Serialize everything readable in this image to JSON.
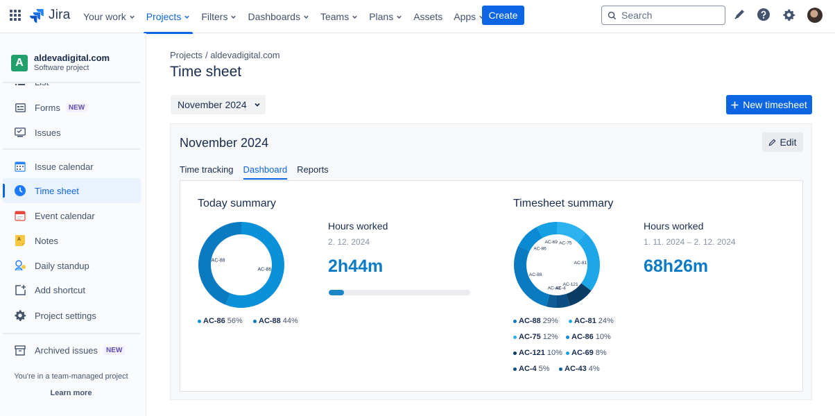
{
  "topnav": {
    "app_name": "Jira",
    "items": [
      {
        "label": "Your work"
      },
      {
        "label": "Projects"
      },
      {
        "label": "Filters"
      },
      {
        "label": "Dashboards"
      },
      {
        "label": "Teams"
      },
      {
        "label": "Plans"
      },
      {
        "label": "Assets"
      },
      {
        "label": "Apps"
      }
    ],
    "active_item": "Projects",
    "create_label": "Create",
    "search_placeholder": "Search",
    "accent": "#0c66e4"
  },
  "sidebar": {
    "project_name": "aldevadigital.com",
    "project_type": "Software project",
    "project_icon_letter": "A",
    "items": [
      {
        "label": "List",
        "icon": "list-icon"
      },
      {
        "label": "Forms",
        "icon": "forms-icon",
        "badge": "NEW"
      },
      {
        "label": "Issues",
        "icon": "issues-icon"
      },
      {
        "label": "Issue calendar",
        "icon": "calendar-icon"
      },
      {
        "label": "Time sheet",
        "icon": "clock-icon",
        "active": true
      },
      {
        "label": "Event calendar",
        "icon": "event-calendar-icon"
      },
      {
        "label": "Notes",
        "icon": "notes-icon"
      },
      {
        "label": "Daily standup",
        "icon": "standup-icon"
      },
      {
        "label": "Add shortcut",
        "icon": "add-shortcut-icon"
      },
      {
        "label": "Project settings",
        "icon": "gear-icon"
      },
      {
        "label": "Archived issues",
        "icon": "archive-icon",
        "badge": "NEW"
      }
    ],
    "team_note": "You're in a team-managed project",
    "learn_more": "Learn more"
  },
  "main": {
    "breadcrumb": [
      "Projects",
      "/ aldevadigital.com"
    ],
    "title": "Time sheet",
    "month_selector": "November 2024",
    "new_timesheet_label": "New timesheet",
    "panel": {
      "title": "November 2024",
      "edit_label": "Edit",
      "tabs": [
        "Time tracking",
        "Dashboard",
        "Reports"
      ],
      "active_tab": "Dashboard"
    }
  },
  "today_summary": {
    "title": "Today summary",
    "hours_label": "Hours worked",
    "date": "2. 12. 2024",
    "hours_value": "2h44m",
    "progress": 0.11,
    "legend": [
      {
        "key": "AC-86",
        "pct": "56%"
      },
      {
        "key": "AC-88",
        "pct": "44%"
      }
    ]
  },
  "timesheet_summary": {
    "title": "Timesheet summary",
    "hours_label": "Hours worked",
    "date_range": "1. 11. 2024  –  2. 12. 2024",
    "hours_value": "68h26m",
    "legend": [
      {
        "key": "AC-88",
        "pct": "29%"
      },
      {
        "key": "AC-81",
        "pct": "24%"
      },
      {
        "key": "AC-75",
        "pct": "12%"
      },
      {
        "key": "AC-86",
        "pct": "10%"
      },
      {
        "key": "AC-121",
        "pct": "10%"
      },
      {
        "key": "AC-69",
        "pct": "8%"
      },
      {
        "key": "AC-4",
        "pct": "5%"
      },
      {
        "key": "AC-43",
        "pct": "4%"
      }
    ]
  },
  "chart_data": [
    {
      "type": "pie",
      "title": "Today summary",
      "categories": [
        "AC-86",
        "AC-88"
      ],
      "values": [
        56,
        44
      ],
      "colors": [
        "#0b90da",
        "#0a7bc0"
      ]
    },
    {
      "type": "pie",
      "title": "Timesheet summary",
      "categories": [
        "AC-75",
        "AC-81",
        "AC-121",
        "AC-4",
        "AC-43",
        "AC-88",
        "AC-86",
        "AC-69"
      ],
      "values": [
        12,
        24,
        10,
        5,
        4,
        29,
        10,
        8
      ],
      "colors": [
        "#2db2f0",
        "#1ea7e8",
        "#0a3d66",
        "#0b4f82",
        "#0e5c96",
        "#0a7bc0",
        "#0b8ad4",
        "#14a0e3"
      ]
    }
  ]
}
